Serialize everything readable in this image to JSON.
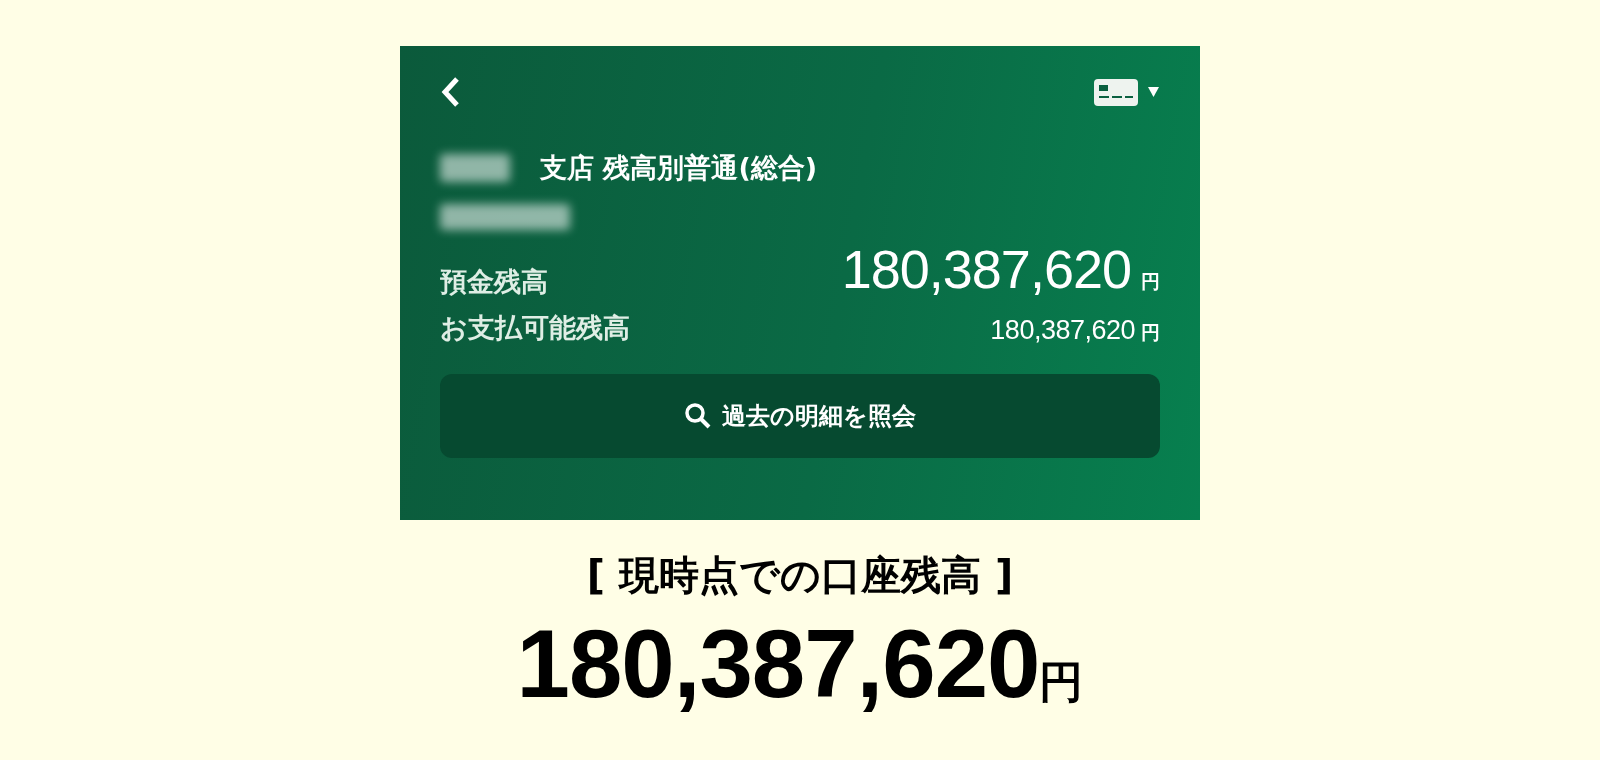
{
  "account": {
    "title": "支店 残高別普通(総合)"
  },
  "balances": [
    {
      "kind": "main",
      "label": "預金残高",
      "amount": "180,387,620",
      "unit": "円"
    },
    {
      "kind": "sub",
      "label": "お支払可能残高",
      "amount": "180,387,620",
      "unit": "円"
    }
  ],
  "history_button": {
    "label": "過去の明細を照会"
  },
  "summary": {
    "caption": "[ 現時点での口座残高 ]",
    "amount": "180,387,620",
    "unit": "円"
  }
}
